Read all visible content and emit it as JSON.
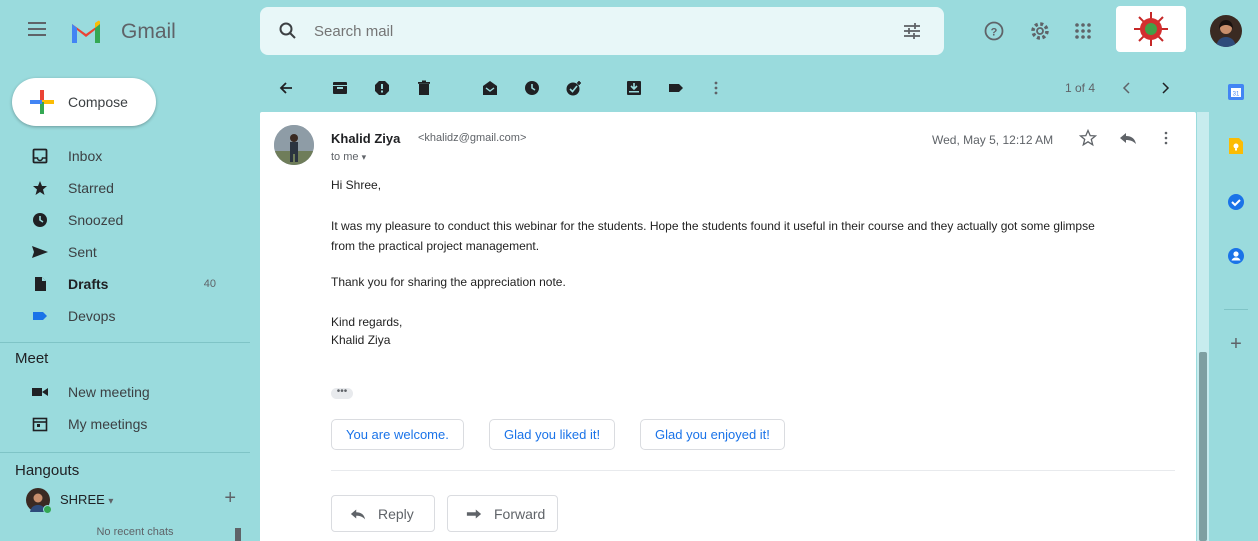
{
  "app": {
    "name": "Gmail"
  },
  "search": {
    "placeholder": "Search mail"
  },
  "compose": {
    "label": "Compose"
  },
  "nav": {
    "items": [
      {
        "label": "Inbox",
        "icon": "inbox-icon"
      },
      {
        "label": "Starred",
        "icon": "star-icon"
      },
      {
        "label": "Snoozed",
        "icon": "clock-icon"
      },
      {
        "label": "Sent",
        "icon": "send-icon"
      },
      {
        "label": "Drafts",
        "icon": "draft-icon",
        "count": "40",
        "bold": true
      },
      {
        "label": "Devops",
        "icon": "label-icon",
        "color": "#1a73e8"
      }
    ]
  },
  "meet": {
    "title": "Meet",
    "items": [
      {
        "label": "New meeting",
        "icon": "video-icon"
      },
      {
        "label": "My meetings",
        "icon": "calendar-icon"
      }
    ]
  },
  "hangouts": {
    "title": "Hangouts",
    "user": "SHREE",
    "empty": "No recent chats"
  },
  "toolbar": {
    "pager": "1 of 4"
  },
  "message": {
    "sender_name": "Khalid Ziya",
    "sender_email": "<khalidz@gmail.com>",
    "recipient": "to me",
    "date": "Wed, May 5, 12:12 AM",
    "greeting": "Hi Shree,",
    "paragraph1_line1": "It was my pleasure to conduct this webinar for the students. Hope the students found it useful in their course and they actually got some glimpse",
    "paragraph1_line2": "from the practical project management.",
    "paragraph2": "Thank you for sharing the appreciation note.",
    "signoff": "Kind regards,",
    "signature": "Khalid Ziya",
    "ellipsis": "•••"
  },
  "smart_replies": [
    "You are welcome.",
    "Glad you liked it!",
    "Glad you enjoyed it!"
  ],
  "actions": {
    "reply": "Reply",
    "forward": "Forward"
  },
  "colors": {
    "background": "#9adbdd",
    "accent": "#1a73e8",
    "gmail_red": "#ea4335"
  }
}
